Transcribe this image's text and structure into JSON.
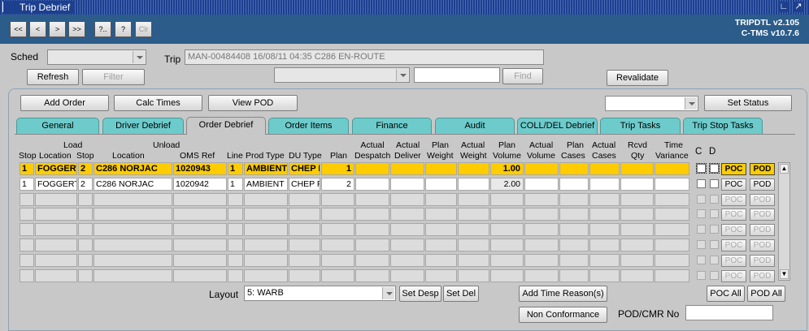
{
  "window": {
    "title": "Trip Debrief"
  },
  "header": {
    "nav_buttons": [
      "<<",
      "<",
      ">",
      ">>",
      "?..",
      "?",
      "Clr"
    ],
    "version_line1": "TRIPDTL v2.105",
    "version_line2": "C-TMS v10.7.6"
  },
  "top": {
    "sched_label": "Sched",
    "sched_value": "",
    "trip_label": "Trip",
    "trip_value": "MAN-00484408 16/08/11 04:35  C286       EN-ROUTE",
    "refresh": "Refresh",
    "filter": "Filter",
    "find": "Find",
    "revalidate": "Revalidate"
  },
  "panel": {
    "add_order": "Add Order",
    "calc_times": "Calc Times",
    "view_pod": "View POD",
    "status_value": "",
    "set_status": "Set Status"
  },
  "tabs": [
    "General",
    "Driver Debrief",
    "Order Debrief",
    "Order Items",
    "Finance",
    "Audit",
    "COLL/DEL Debrief",
    "Trip Tasks",
    "Trip Stop Tasks"
  ],
  "active_tab": "Order Debrief",
  "grid": {
    "headers": {
      "load": "Load",
      "unload": "Unload",
      "stop1": "Stop",
      "location1": "Location",
      "stop2": "Stop",
      "location2": "Location",
      "oms_ref": "OMS Ref",
      "line": "Line",
      "prod_type": "Prod Type",
      "du_type": "DU Type",
      "plan": "Plan",
      "actual_despatch_1": "Actual",
      "actual_despatch_2": "Despatch",
      "actual_deliver_1": "Actual",
      "actual_deliver_2": "Deliver",
      "plan_weight_1": "Plan",
      "plan_weight_2": "Weight",
      "actual_weight_1": "Actual",
      "actual_weight_2": "Weight",
      "plan_volume_1": "Plan",
      "plan_volume_2": "Volume",
      "actual_volume_1": "Actual",
      "actual_volume_2": "Volume",
      "plan_cases_1": "Plan",
      "plan_cases_2": "Cases",
      "actual_cases_1": "Actual",
      "actual_cases_2": "Cases",
      "rcvd_qty_1": "Rcvd",
      "rcvd_qty_2": "Qty",
      "time_variance_1": "Time",
      "time_variance_2": "Variance",
      "c": "C",
      "d": "D"
    },
    "rows": [
      {
        "stop": "1",
        "load_location": "FOGGERT",
        "unload_stop": "2",
        "unload_location": "C286 NORJAC",
        "oms_ref": "1020943",
        "line": "1",
        "prod_type": "AMBIENT",
        "du_type": "CHEP P",
        "plan": "1",
        "plan_volume": "1.00",
        "poc": "POC",
        "pod": "POD"
      },
      {
        "stop": "1",
        "load_location": "FOGGERT",
        "unload_stop": "2",
        "unload_location": "C286 NORJAC",
        "oms_ref": "1020942",
        "line": "1",
        "prod_type": "AMBIENT",
        "du_type": "CHEP P",
        "plan": "2",
        "plan_volume": "2.00",
        "poc": "POC",
        "pod": "POD"
      }
    ],
    "empty_row_buttons": {
      "poc": "POC",
      "pod": "POD"
    }
  },
  "bottom": {
    "layout_label": "Layout",
    "layout_value": "5: WARB",
    "set_desp": "Set Desp",
    "set_del": "Set Del",
    "add_time_reason": "Add Time Reason(s)",
    "non_conformance": "Non Conformance",
    "poc_all": "POC All",
    "pod_all": "POD All",
    "pod_cmr_label": "POD/CMR No",
    "pod_cmr_value": ""
  }
}
